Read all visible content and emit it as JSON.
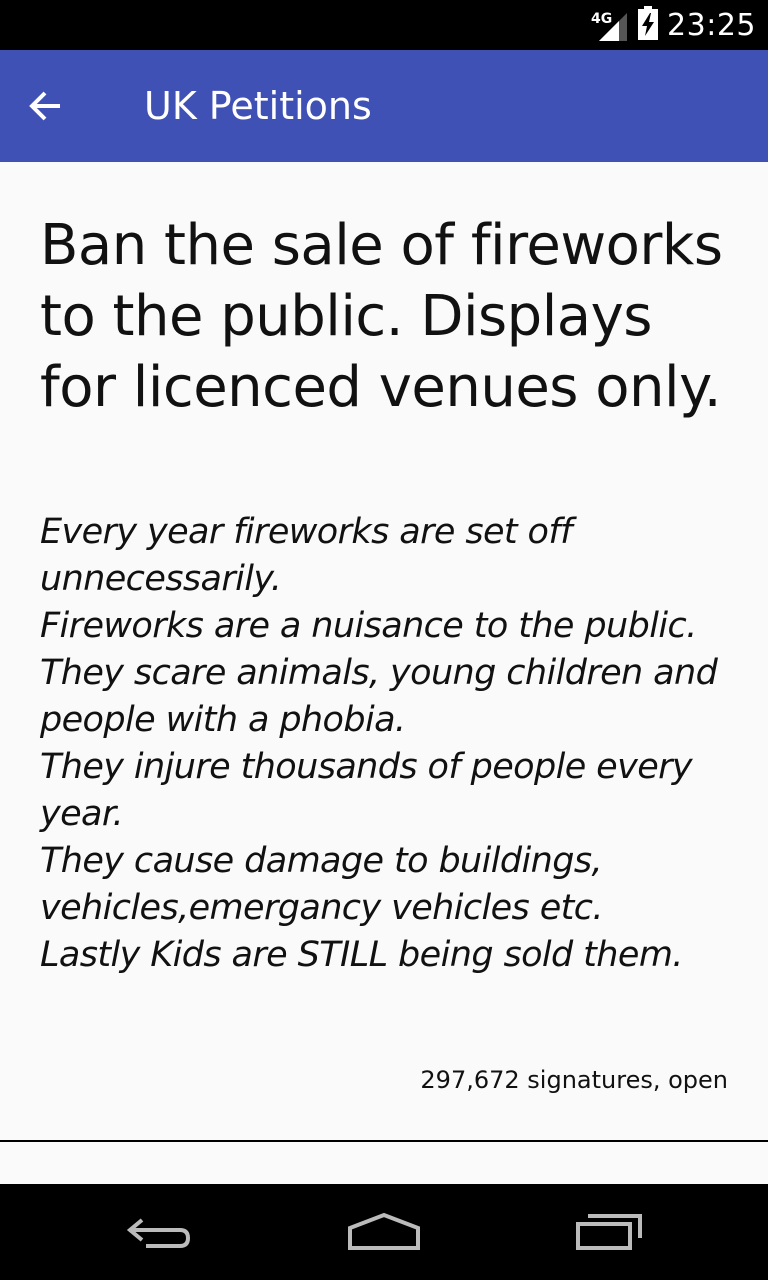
{
  "status_bar": {
    "network_type": "4G",
    "time": "23:25",
    "icons": [
      "signal-icon",
      "battery-charging-icon"
    ]
  },
  "app_bar": {
    "title": "UK Petitions",
    "back_icon": "arrow-left-icon"
  },
  "petition": {
    "title": "Ban the sale of fireworks to the public. Displays for licenced venues only.",
    "body_lines": [
      "Every year fireworks are set off unnecessarily.",
      "Fireworks are a nuisance to the public.",
      "They scare animals, young children and people with a phobia.",
      "They injure thousands of people every year.",
      "They cause damage to buildings, vehicles,emergancy vehicles etc.",
      "Lastly Kids are STILL being sold them."
    ],
    "status": "297,672 signatures, open"
  },
  "nav_bar": {
    "icons": [
      "back-nav-icon",
      "home-nav-icon",
      "recents-nav-icon"
    ]
  }
}
